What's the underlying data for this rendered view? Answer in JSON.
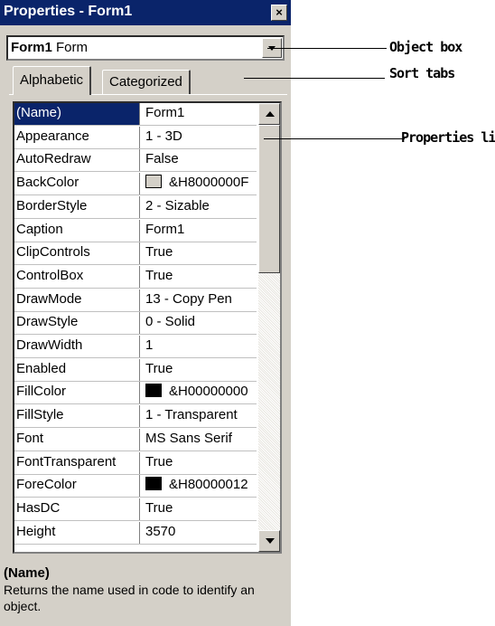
{
  "window": {
    "title": "Properties - Form1",
    "close_glyph": "×"
  },
  "object_box": {
    "name": "Form1",
    "type": "Form"
  },
  "tabs": [
    {
      "label": "Alphabetic",
      "active": true
    },
    {
      "label": "Categorized",
      "active": false
    }
  ],
  "properties": [
    {
      "name": "(Name)",
      "value": "Form1"
    },
    {
      "name": "Appearance",
      "value": "1 - 3D"
    },
    {
      "name": "AutoRedraw",
      "value": "False"
    },
    {
      "name": "BackColor",
      "value": "&H8000000F",
      "swatch": "#d4d0c8"
    },
    {
      "name": "BorderStyle",
      "value": "2 - Sizable"
    },
    {
      "name": "Caption",
      "value": "Form1"
    },
    {
      "name": "ClipControls",
      "value": "True"
    },
    {
      "name": "ControlBox",
      "value": "True"
    },
    {
      "name": "DrawMode",
      "value": "13 - Copy Pen"
    },
    {
      "name": "DrawStyle",
      "value": "0 - Solid"
    },
    {
      "name": "DrawWidth",
      "value": "1"
    },
    {
      "name": "Enabled",
      "value": "True"
    },
    {
      "name": "FillColor",
      "value": "&H00000000",
      "swatch": "#000000"
    },
    {
      "name": "FillStyle",
      "value": "1 - Transparent"
    },
    {
      "name": "Font",
      "value": "MS Sans Serif"
    },
    {
      "name": "FontTransparent",
      "value": "True"
    },
    {
      "name": "ForeColor",
      "value": "&H80000012",
      "swatch": "#000000"
    },
    {
      "name": "HasDC",
      "value": "True"
    },
    {
      "name": "Height",
      "value": "3570"
    }
  ],
  "description": {
    "title": "(Name)",
    "text": "Returns the name used in code to identify an object."
  },
  "callouts": [
    {
      "label": "Object box"
    },
    {
      "label": "Sort tabs"
    },
    {
      "label": "Properties list"
    }
  ],
  "colors": {
    "title_bar": "#0a246a",
    "selection": "#0a246a",
    "window_face": "#d4d0c8"
  }
}
